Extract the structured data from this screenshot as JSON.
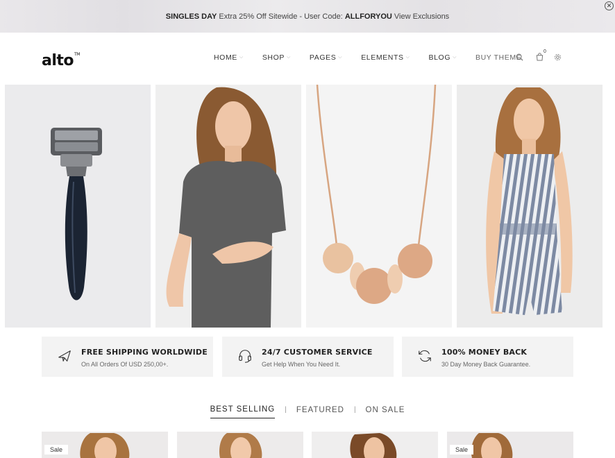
{
  "promo": {
    "event": "SINGLES DAY",
    "text": "Extra 25% Off Sitewide - User Code:",
    "code": "ALLFORYOU",
    "link": "View Exclusions",
    "close_glyph": "✕"
  },
  "brand": {
    "name": "alto",
    "tm": "TM"
  },
  "nav": {
    "items": [
      {
        "label": "HOME"
      },
      {
        "label": "SHOP"
      },
      {
        "label": "PAGES"
      },
      {
        "label": "ELEMENTS"
      },
      {
        "label": "BLOG"
      }
    ],
    "chevron": "⌵",
    "buy_label": "BUY THEME",
    "cart_count": "0",
    "icons": [
      "search-icon",
      "cart-icon",
      "settings-icon"
    ]
  },
  "hero": {
    "tiles": [
      "razor",
      "model-grey-dress",
      "wooden-bead-necklace",
      "model-striped-romper"
    ]
  },
  "features": [
    {
      "icon": "airplane-icon",
      "title": "FREE SHIPPING WORLDWIDE",
      "subtitle": "On All Orders Of USD 250,00+."
    },
    {
      "icon": "headset-icon",
      "title": "24/7 CUSTOMER SERVICE",
      "subtitle": "Get Help When You Need It."
    },
    {
      "icon": "refresh-icon",
      "title": "100% MONEY BACK",
      "subtitle": "30 Day Money Back Guarantee."
    }
  ],
  "tabs": {
    "items": [
      {
        "label": "BEST SELLING",
        "active": true
      },
      {
        "label": "FEATURED",
        "active": false
      },
      {
        "label": "ON SALE",
        "active": false
      }
    ],
    "separator": "|"
  },
  "products": {
    "sale_label": "Sale",
    "cards": [
      {
        "sale": true
      },
      {
        "sale": false
      },
      {
        "sale": false
      },
      {
        "sale": true
      }
    ]
  },
  "colors": {
    "text": "#222222",
    "muted": "#666666",
    "feature_bg": "#f3f3f3"
  }
}
